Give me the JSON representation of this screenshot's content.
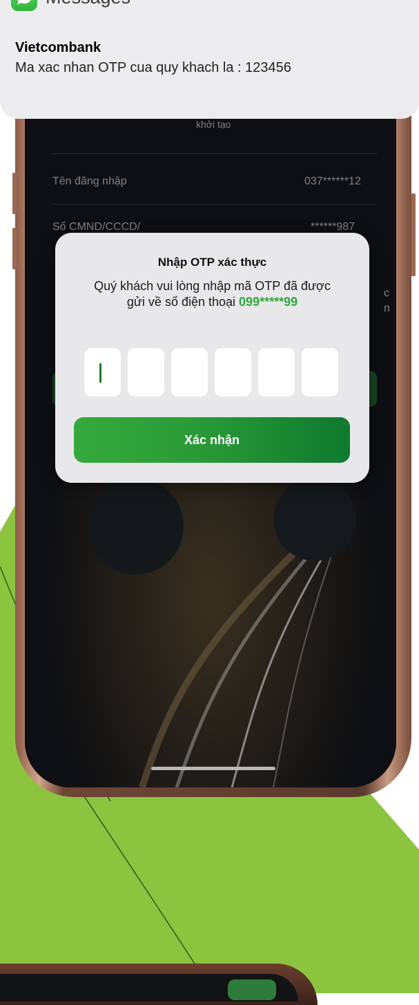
{
  "notification": {
    "app_name": "Messages",
    "app_icon": "messages-bubble-icon",
    "sender": "Vietcombank",
    "body": "Ma xac nhan OTP cua quy khach la : 123456"
  },
  "background_screen": {
    "top_fragment": "khởi tạo",
    "rows": [
      {
        "label": "Tên đăng nhập",
        "value": "037******12"
      },
      {
        "label": "Số CMND/CCCD/",
        "value": "******987"
      }
    ],
    "right_fragments": [
      "c",
      "n"
    ]
  },
  "otp_dialog": {
    "title": "Nhập OTP xác thực",
    "message_line1": "Quý khách vui lòng nhập mã OTP đã được",
    "message_line2_prefix": "gửi về số điện thoại ",
    "phone_number": "099*****99",
    "digits_count": 6,
    "confirm_label": "Xác nhận"
  },
  "colors": {
    "brand_green": "#2faa3a",
    "background_green": "#8cc43f",
    "button_gradient_start": "#35a93c",
    "button_gradient_end": "#0e7a2f"
  }
}
